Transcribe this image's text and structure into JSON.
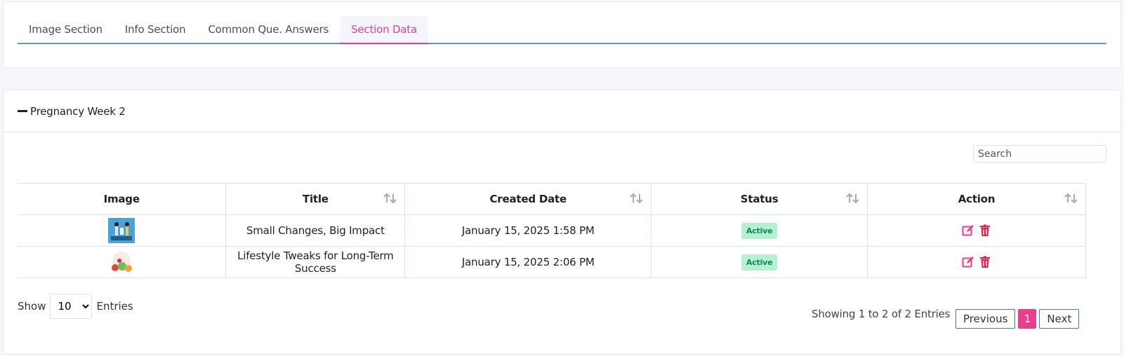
{
  "tabs": [
    "Image Section",
    "Info Section",
    "Common Que. Answers",
    "Section Data"
  ],
  "active_tab": "Section Data",
  "panel": {
    "title": "Pregnancy Week 2"
  },
  "search": {
    "placeholder": "Search"
  },
  "table": {
    "columns": [
      "Image",
      "Title",
      "Created Date",
      "Status",
      "Action"
    ],
    "rows": [
      {
        "image_icon": "couple-yoga-thumbnail",
        "title": "Small Changes, Big Impact",
        "created": "January 15, 2025 1:58 PM",
        "status": "Active"
      },
      {
        "image_icon": "fruits-veggies-thumbnail",
        "title": "Lifestyle Tweaks for Long-Term Success",
        "created": "January 15, 2025 2:06 PM",
        "status": "Active"
      }
    ]
  },
  "length": {
    "show_label": "Show",
    "value": "10",
    "entries_label": "Entries"
  },
  "info": "Showing 1 to 2 of 2 Entries",
  "pagination": {
    "previous": "Previous",
    "current": "1",
    "next": "Next"
  },
  "colors": {
    "accent": "#e83e8c",
    "tab_underline": "#5b9bd5",
    "badge_bg": "#b6f0d2",
    "badge_text": "#11864f"
  }
}
